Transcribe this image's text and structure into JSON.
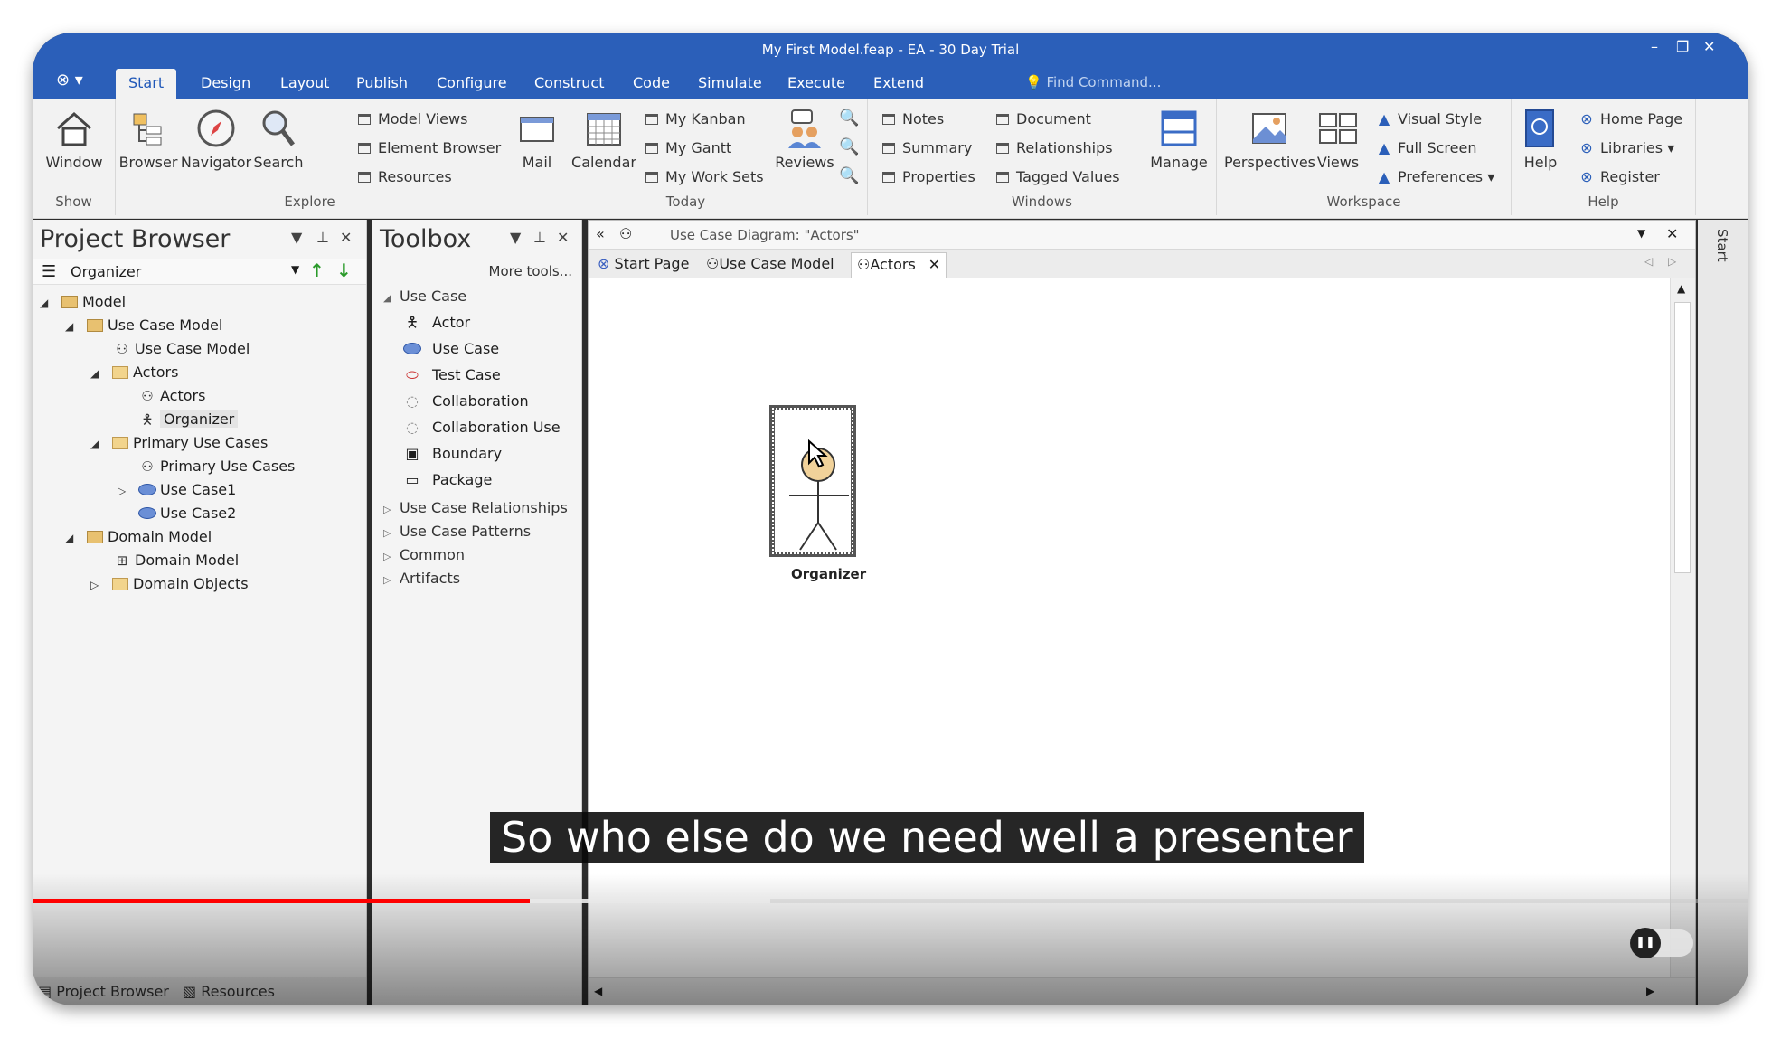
{
  "window": {
    "title": "My First Model.feap - EA - 30 Day Trial"
  },
  "ribbon_tabs": [
    "Start",
    "Design",
    "Layout",
    "Publish",
    "Configure",
    "Construct",
    "Code",
    "Simulate",
    "Execute",
    "Extend"
  ],
  "find_command": "Find Command...",
  "ribbon": {
    "show": {
      "label": "Show",
      "window": "Window"
    },
    "explore": {
      "label": "Explore",
      "browser": "Browser",
      "navigator": "Navigator",
      "search": "Search",
      "model_views": "Model Views",
      "element_browser": "Element Browser",
      "resources": "Resources"
    },
    "today": {
      "label": "Today",
      "mail": "Mail",
      "calendar": "Calendar",
      "my_kanban": "My Kanban",
      "my_gantt": "My Gantt",
      "my_work_sets": "My Work Sets",
      "reviews": "Reviews"
    },
    "windows": {
      "label": "Windows",
      "notes": "Notes",
      "summary": "Summary",
      "properties": "Properties",
      "document": "Document",
      "relationships": "Relationships",
      "tagged_values": "Tagged Values",
      "manage": "Manage"
    },
    "workspace": {
      "label": "Workspace",
      "perspectives": "Perspectives",
      "views": "Views",
      "visual_style": "Visual Style",
      "full_screen": "Full Screen",
      "preferences": "Preferences"
    },
    "help": {
      "label": "Help",
      "help": "Help",
      "home_page": "Home Page",
      "libraries": "Libraries",
      "register": "Register"
    }
  },
  "project_browser": {
    "title": "Project Browser",
    "organizer": "Organizer",
    "tree": [
      {
        "label": "Model",
        "icon": "package-icon"
      },
      {
        "label": "Use Case Model",
        "icon": "package-icon"
      },
      {
        "label": "Use Case Model",
        "icon": "diagram-icon"
      },
      {
        "label": "Actors",
        "icon": "folder-icon"
      },
      {
        "label": "Actors",
        "icon": "diagram-icon"
      },
      {
        "label": "Organizer",
        "icon": "actor-icon",
        "selected": true
      },
      {
        "label": "Primary Use Cases",
        "icon": "folder-icon"
      },
      {
        "label": "Primary Use Cases",
        "icon": "diagram-icon"
      },
      {
        "label": "Use Case1",
        "icon": "use-case-icon"
      },
      {
        "label": "Use Case2",
        "icon": "use-case-icon"
      },
      {
        "label": "Domain Model",
        "icon": "package-icon"
      },
      {
        "label": "Domain Model",
        "icon": "class-diagram-icon"
      },
      {
        "label": "Domain Objects",
        "icon": "folder-icon"
      }
    ],
    "bottom_tabs": [
      "Project Browser",
      "Resources"
    ]
  },
  "toolbox": {
    "title": "Toolbox",
    "more_tools": "More tools...",
    "section": "Use Case",
    "items": [
      "Actor",
      "Use Case",
      "Test Case",
      "Collaboration",
      "Collaboration Use",
      "Boundary",
      "Package"
    ],
    "collapsed_sections": [
      "Use Case Relationships",
      "Use Case Patterns",
      "Common",
      "Artifacts"
    ]
  },
  "diagram": {
    "header": "Use Case Diagram: \"Actors\"",
    "tabs": [
      "Start Page",
      "Use Case Model",
      "Actors"
    ],
    "actor_name": "Organizer"
  },
  "right_strip": {
    "label": "Start"
  },
  "video": {
    "subtitle": "So who else do we need well a presenter",
    "progress_played": 0.29,
    "progress_buffered": 0.43
  },
  "colors": {
    "title_bar": "#2b5fb9",
    "progress": "#ff0000"
  }
}
